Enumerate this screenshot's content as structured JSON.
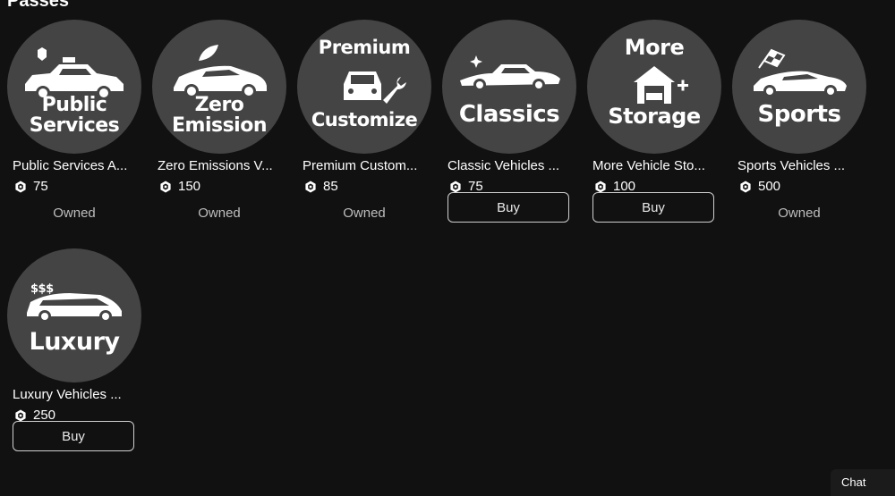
{
  "section": {
    "title": "Passes"
  },
  "passes": [
    {
      "image_text": [
        "Public",
        "Services"
      ],
      "name": "Public Services A...",
      "price": "75",
      "status": "Owned",
      "icon": "police-car-icon"
    },
    {
      "image_text": [
        "Zero",
        "Emission"
      ],
      "name": "Zero Emissions V...",
      "price": "150",
      "status": "Owned",
      "icon": "electric-car-icon"
    },
    {
      "image_text": [
        "Premium",
        "Customize"
      ],
      "name": "Premium Custom...",
      "price": "85",
      "status": "Owned",
      "icon": "car-wrench-icon"
    },
    {
      "image_text": [
        "Classics"
      ],
      "name": "Classic Vehicles ...",
      "price": "75",
      "status": "Buy",
      "icon": "classic-car-icon"
    },
    {
      "image_text": [
        "More",
        "Storage"
      ],
      "name": "More Vehicle Sto...",
      "price": "100",
      "status": "Buy",
      "icon": "garage-icon"
    },
    {
      "image_text": [
        "Sports"
      ],
      "name": "Sports Vehicles ...",
      "price": "500",
      "status": "Owned",
      "icon": "sports-car-flag-icon"
    },
    {
      "image_text": [
        "$$$",
        "Luxury"
      ],
      "name": "Luxury Vehicles ...",
      "price": "250",
      "status": "Buy",
      "icon": "luxury-car-icon"
    }
  ],
  "chat": {
    "label": "Chat"
  },
  "colors": {
    "background": "#111111",
    "thumb": "#444444",
    "owned_text": "#bdbdbd",
    "button_border": "#cfcfcf"
  }
}
